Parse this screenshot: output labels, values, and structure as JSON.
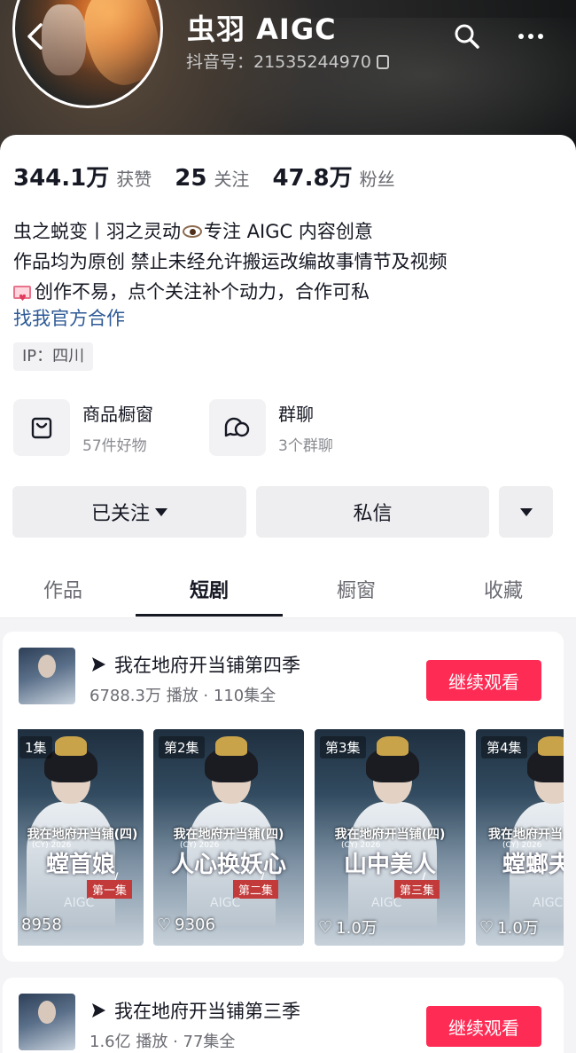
{
  "profile": {
    "name": "虫羽 AIGC",
    "douyin_id": "抖音号：21535244970"
  },
  "stats": [
    {
      "value": "344.1万",
      "label": "获赞"
    },
    {
      "value": "25",
      "label": "关注"
    },
    {
      "value": "47.8万",
      "label": "粉丝"
    }
  ],
  "bio": {
    "line1_a": "虫之蜕变丨羽之灵动",
    "line1_b": "专注 AIGC 内容创意",
    "line2": "作品均为原创 禁止未经允许搬运改编故事情节及视频",
    "line3": "创作不易，点个关注补个动力，合作可私",
    "official_link": "找我官方合作",
    "ip": "IP：四川"
  },
  "features": [
    {
      "title": "商品橱窗",
      "sub": "57件好物",
      "icon": "shopping-bag-icon"
    },
    {
      "title": "群聊",
      "sub": "3个群聊",
      "icon": "chat-bubbles-icon"
    }
  ],
  "actions": {
    "followed": "已关注",
    "message": "私信"
  },
  "tabs": [
    "作品",
    "短剧",
    "橱窗",
    "收藏"
  ],
  "active_tab": "短剧",
  "dramas": [
    {
      "title": "我在地府开当铺第四季",
      "meta": "6788.3万 播放 · 110集全",
      "button": "继续观看",
      "episodes": [
        {
          "label": "1集",
          "subtitle": "螳首娘",
          "ep_num": "第一集",
          "likes": "8958"
        },
        {
          "label": "第2集",
          "subtitle": "人心换妖心",
          "ep_num": "第二集",
          "likes": "9306"
        },
        {
          "label": "第3集",
          "subtitle": "山中美人",
          "ep_num": "第三集",
          "likes": "1.0万"
        },
        {
          "label": "第4集",
          "subtitle": "螳螂夫",
          "ep_num": "",
          "likes": "1.0万"
        }
      ],
      "series_text": "我在地府开当铺(四)",
      "series_text_cut": "我在地府开当",
      "cy": "(CY) 2026",
      "aigc": "AIGC"
    },
    {
      "title": "我在地府开当铺第三季",
      "meta": "1.6亿 播放 · 77集全",
      "button": "继续观看"
    }
  ],
  "colors": {
    "accent": "#fe2c55",
    "link": "#2e5a96",
    "text": "#161823",
    "muted": "#6b6c73"
  }
}
